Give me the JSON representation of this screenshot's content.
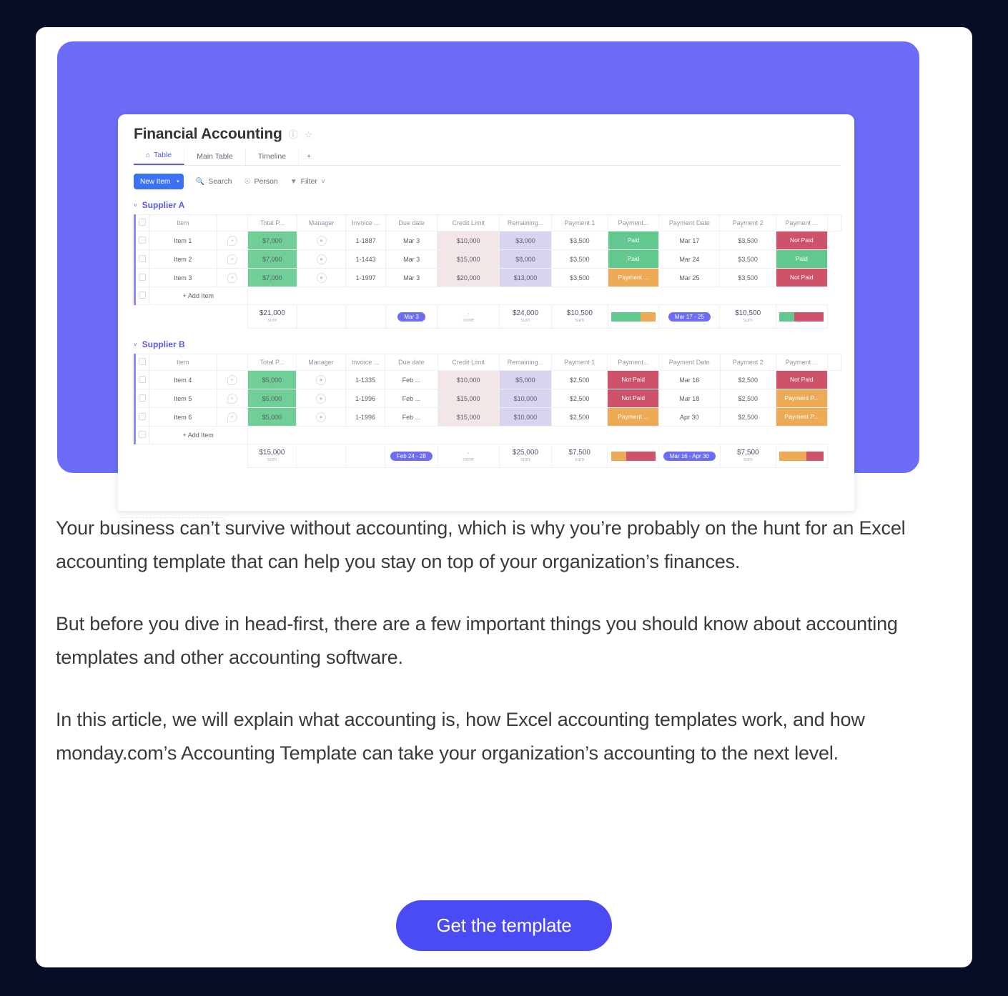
{
  "theme": {
    "page_bg": "#080D26",
    "card_bg": "#FFFFFF",
    "hero_purple": "#6C6CF6",
    "accent_blue": "#4B4BF5",
    "board_button_blue": "#3B71F5",
    "group_purple": "#5A5AE6",
    "status_paid_green": "#61C98D",
    "status_notpaid_red": "#CE5269",
    "status_pending_orange": "#EEAB57",
    "total_green": "#6FCF97",
    "credit_limit_bg": "#F2E6E6",
    "remaining_bg": "#D9D3EF"
  },
  "board": {
    "title": "Financial Accounting",
    "title_icons": [
      "info-icon",
      "star-icon"
    ],
    "tabs": [
      {
        "label": "Table",
        "icon": "home-icon",
        "active": true
      },
      {
        "label": "Main Table",
        "icon": "",
        "active": false
      },
      {
        "label": "Timeline",
        "icon": "",
        "active": false
      },
      {
        "label": "+",
        "icon": "plus-icon",
        "active": false
      }
    ],
    "toolbar": {
      "new_item_label": "New Item",
      "new_item_caret": "▾",
      "actions": [
        {
          "label": "Search",
          "icon": "search-icon"
        },
        {
          "label": "Person",
          "icon": "person-icon"
        },
        {
          "label": "Filter",
          "icon": "filter-icon",
          "caret": "˅"
        }
      ]
    },
    "columns": [
      "Item",
      "",
      "Total P...",
      "Manager",
      "Invoice ...",
      "Due date",
      "Credit Limit",
      "Remaining...",
      "Payment 1",
      "Payment...",
      "Payment Date",
      "Payment 2",
      "Payment ..."
    ],
    "add_item_label": "+ Add Item",
    "sum_label": "sum",
    "none_label": "none",
    "dash": "-",
    "groups": [
      {
        "name": "Supplier A",
        "caret": "˅",
        "rows": [
          {
            "item": "Item 1",
            "total": "$7,000",
            "invoice": "1-1887",
            "due": "Mar 3",
            "credit": "$10,000",
            "remaining": "$3,000",
            "payment1": "$3,500",
            "status1": "Paid",
            "status1_kind": "paid",
            "payment_date": "Mar 17",
            "payment2": "$3,500",
            "status2": "Not Paid",
            "status2_kind": "notpaid"
          },
          {
            "item": "Item 2",
            "total": "$7,000",
            "invoice": "1-1443",
            "due": "Mar 3",
            "credit": "$15,000",
            "remaining": "$8,000",
            "payment1": "$3,500",
            "status1": "Paid",
            "status1_kind": "paid",
            "payment_date": "Mar 24",
            "payment2": "$3,500",
            "status2": "Paid",
            "status2_kind": "paid"
          },
          {
            "item": "Item 3",
            "total": "$7,000",
            "invoice": "1-1997",
            "due": "Mar 3",
            "credit": "$20,000",
            "remaining": "$13,000",
            "payment1": "$3,500",
            "status1": "Payment ...",
            "status1_kind": "pending",
            "payment_date": "Mar 25",
            "payment2": "$3,500",
            "status2": "Not Paid",
            "status2_kind": "notpaid"
          }
        ],
        "summary": {
          "total": "$21,000",
          "due_chip": "Mar 3",
          "credit": "-",
          "remaining": "$24,000",
          "payment1": "$10,500",
          "status1_bar": [
            {
              "color": "#61C98D",
              "pct": 66
            },
            {
              "color": "#EEAB57",
              "pct": 34
            }
          ],
          "date_chip": "Mar 17 - 25",
          "payment2": "$10,500",
          "status2_bar": [
            {
              "color": "#61C98D",
              "pct": 34
            },
            {
              "color": "#CE5269",
              "pct": 66
            }
          ]
        }
      },
      {
        "name": "Supplier B",
        "caret": "˅",
        "rows": [
          {
            "item": "Item 4",
            "total": "$5,000",
            "invoice": "1-1335",
            "due": "Feb ...",
            "credit": "$10,000",
            "remaining": "$5,000",
            "payment1": "$2,500",
            "status1": "Not Paid",
            "status1_kind": "notpaid",
            "payment_date": "Mar 16",
            "payment2": "$2,500",
            "status2": "Not Paid",
            "status2_kind": "notpaid"
          },
          {
            "item": "Item 5",
            "total": "$5,000",
            "invoice": "1-1996",
            "due": "Feb ...",
            "credit": "$15,000",
            "remaining": "$10,000",
            "payment1": "$2,500",
            "status1": "Not Paid",
            "status1_kind": "notpaid",
            "payment_date": "Mar 18",
            "payment2": "$2,500",
            "status2": "Payment P...",
            "status2_kind": "pending"
          },
          {
            "item": "Item 6",
            "total": "$5,000",
            "invoice": "1-1996",
            "due": "Feb ...",
            "credit": "$15,000",
            "remaining": "$10,000",
            "payment1": "$2,500",
            "status1": "Payment ...",
            "status1_kind": "pending",
            "payment_date": "Apr 30",
            "payment2": "$2,500",
            "status2": "Payment P...",
            "status2_kind": "pending"
          }
        ],
        "summary": {
          "total": "$15,000",
          "due_chip": "Feb 24 - 28",
          "credit": "-",
          "remaining": "$25,000",
          "payment1": "$7,500",
          "status1_bar": [
            {
              "color": "#EEAB57",
              "pct": 34
            },
            {
              "color": "#CE5269",
              "pct": 66
            }
          ],
          "date_chip": "Mar 16 - Apr 30",
          "payment2": "$7,500",
          "status2_bar": [
            {
              "color": "#EEAB57",
              "pct": 60
            },
            {
              "color": "#CE5269",
              "pct": 40
            }
          ]
        }
      }
    ]
  },
  "article": {
    "paragraphs": [
      "Your business can’t survive without accounting, which is why you’re probably on the hunt for an Excel accounting template that can help you stay on top of your organization’s finances.",
      "But before you dive in head-first, there are a few important things you should know about accounting templates and other accounting software.",
      "In this article, we will explain what accounting is, how Excel accounting templates work, and how monday.com’s Accounting Template can take your organization’s accounting to the next level."
    ]
  },
  "cta": {
    "label": "Get the template"
  }
}
